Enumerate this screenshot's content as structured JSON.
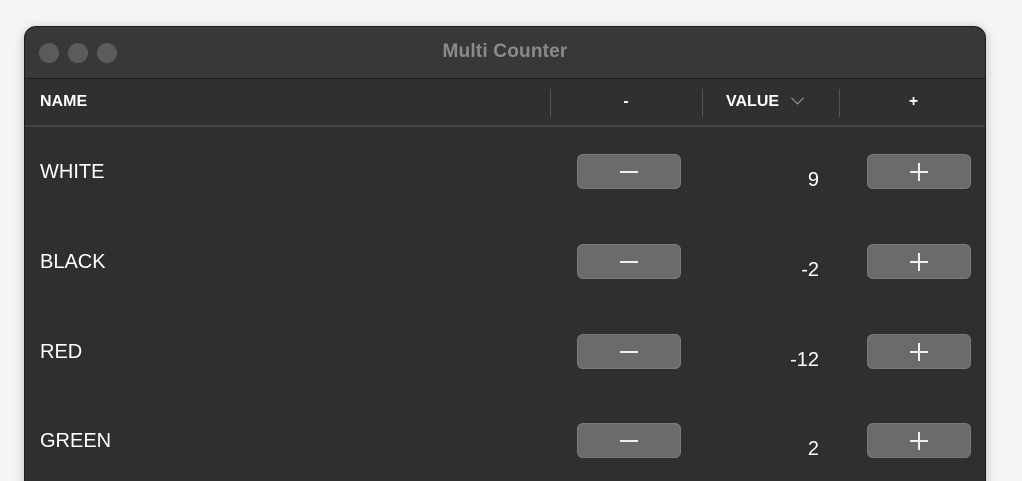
{
  "window": {
    "title": "Multi Counter"
  },
  "table": {
    "columns": {
      "name": "NAME",
      "minus": "-",
      "value": "VALUE",
      "plus": "+"
    },
    "rows": [
      {
        "name": "WHITE",
        "value": "9"
      },
      {
        "name": "BLACK",
        "value": "-2"
      },
      {
        "name": "RED",
        "value": "-12"
      },
      {
        "name": "GREEN",
        "value": "2"
      }
    ]
  },
  "icons": {
    "sort": "chevron-down-icon",
    "decrement": "minus-icon",
    "increment": "plus-icon"
  }
}
